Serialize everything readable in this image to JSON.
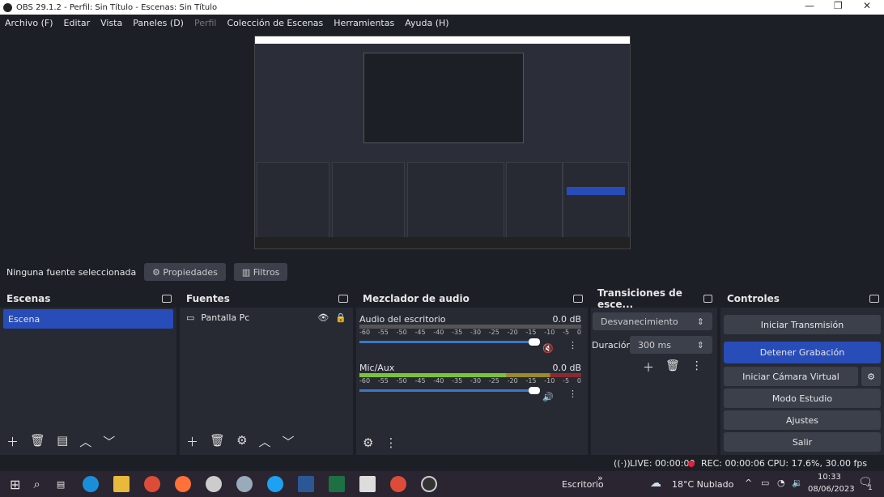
{
  "window": {
    "title": "OBS 29.1.2 - Perfil: Sin Título - Escenas: Sin Título"
  },
  "menu": [
    "Archivo (F)",
    "Editar",
    "Vista",
    "Paneles (D)",
    "Perfil",
    "Colección de Escenas",
    "Herramientas",
    "Ayuda (H)"
  ],
  "source_bar": {
    "label": "Ninguna fuente seleccionada",
    "properties": "Propiedades",
    "filters": "Filtros"
  },
  "scenes": {
    "title": "Escenas",
    "items": [
      "Escena"
    ]
  },
  "sources": {
    "title": "Fuentes",
    "items": [
      "Pantalla Pc"
    ]
  },
  "mixer": {
    "title": "Mezclador de audio",
    "scale": [
      "-60",
      "-55",
      "-50",
      "-45",
      "-40",
      "-35",
      "-30",
      "-25",
      "-20",
      "-15",
      "-10",
      "-5",
      "0"
    ],
    "channels": [
      {
        "name": "Audio del escritorio",
        "db": "0.0 dB",
        "muted": true,
        "volume": 1.0
      },
      {
        "name": "Mic/Aux",
        "db": "0.0 dB",
        "muted": false,
        "volume": 1.0
      }
    ]
  },
  "transitions": {
    "title": "Transiciones de esce...",
    "selected": "Desvanecimiento",
    "duration_label": "Duración",
    "duration": "300 ms"
  },
  "controls": {
    "title": "Controles",
    "buttons": [
      "Iniciar Transmisión",
      "Detener Grabación",
      "Iniciar Cámara Virtual",
      "Modo Estudio",
      "Ajustes",
      "Salir"
    ]
  },
  "status": {
    "live": "LIVE: 00:00:00",
    "rec": "REC: 00:00:06",
    "cpu": "CPU: 17.6%, 30.00 fps"
  },
  "taskbar": {
    "desktop": "Escritorio",
    "weather": "18°C  Nublado",
    "time": "10:33",
    "date": "08/06/2023",
    "notifications": "1"
  },
  "colors": {
    "accent": "#284cb8",
    "rec": "#e0213a"
  }
}
